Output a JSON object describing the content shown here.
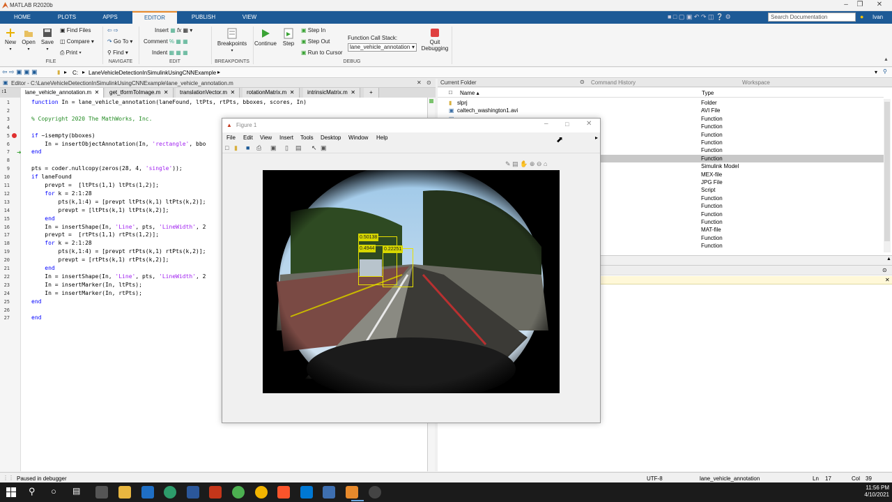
{
  "window": {
    "title": "MATLAB R2020b",
    "user": "Ivan"
  },
  "tabs": [
    "HOME",
    "PLOTS",
    "APPS",
    "EDITOR",
    "PUBLISH",
    "VIEW"
  ],
  "search_placeholder": "Search Documentation",
  "ribbon": {
    "file": {
      "new": "New",
      "open": "Open",
      "save": "Save",
      "find_files": "Find Files",
      "compare": "Compare",
      "print": "Print",
      "group": "FILE"
    },
    "navigate": {
      "goto": "Go To",
      "find": "Find",
      "group": "NAVIGATE"
    },
    "edit": {
      "insert": "Insert",
      "comment": "Comment",
      "indent": "Indent",
      "group": "EDIT"
    },
    "breakpoints": {
      "label": "Breakpoints",
      "group": "BREAKPOINTS"
    },
    "debug": {
      "continue": "Continue",
      "step": "Step",
      "step_in": "Step In",
      "step_out": "Step Out",
      "run_to_cursor": "Run to Cursor",
      "call_stack_label": "Function Call Stack:",
      "call_stack_value": "lane_vehicle_annotation",
      "quit": "Quit",
      "quit2": "Debugging",
      "group": "DEBUG"
    }
  },
  "address": {
    "path": "C: ▸ LaneVehicleDetectionInSimulinkUsingCNNExample ▸",
    "drive": "C:",
    "folder": "LaneVehicleDetectionInSimulinkUsingCNNExample"
  },
  "editor": {
    "header": "Editor - C:\\LaneVehicleDetectionInSimulinkUsingCNNExample\\lane_vehicle_annotation.m",
    "tabs": [
      "lane_vehicle_annotation.m",
      "get_tformToImage.m",
      "translationVector.m",
      "rotationMatrix.m",
      "intrinsicMatrix.m"
    ],
    "lines": [
      "function In = lane_vehicle_annotation(laneFound, ltPts, rtPts, bboxes, scores, In)",
      "",
      "% Copyright 2020 The MathWorks, Inc.",
      "",
      "if ~isempty(bboxes)",
      "    In = insertObjectAnnotation(In, 'rectangle', bbo",
      "end",
      "",
      "pts = coder.nullcopy(zeros(28, 4, 'single'));",
      "if laneFound",
      "    prevpt =  [ltPts(1,1) ltPts(1,2)];",
      "    for k = 2:1:28",
      "        pts(k,1:4) = [prevpt ltPts(k,1) ltPts(k,2)];",
      "        prevpt = [ltPts(k,1) ltPts(k,2)];",
      "    end",
      "    In = insertShape(In, 'Line', pts, 'LineWidth', 2",
      "    prevpt =  [rtPts(1,1) rtPts(1,2)];",
      "    for k = 2:1:28",
      "        pts(k,1:4) = [prevpt rtPts(k,1) rtPts(k,2)];",
      "        prevpt = [rtPts(k,1) rtPts(k,2)];",
      "    end",
      "    In = insertShape(In, 'Line', pts, 'LineWidth', 2",
      "    In = insertMarker(In, ltPts);",
      "    In = insertMarker(In, rtPts);",
      "end",
      "",
      "end"
    ]
  },
  "panels": {
    "current_folder": "Current Folder",
    "command_history": "Command History",
    "workspace": "Workspace",
    "col_name": "Name ▴",
    "col_type": "Type"
  },
  "files": [
    {
      "name": "slprj",
      "type": "Folder"
    },
    {
      "name": "caltech_washington1.avi",
      "type": "AVI File"
    },
    {
      "name": "",
      "type": "Function"
    },
    {
      "name": "",
      "type": "Function"
    },
    {
      "name": "",
      "type": "Function"
    },
    {
      "name": "",
      "type": "Function"
    },
    {
      "name": "",
      "type": "Function"
    },
    {
      "name": "",
      "type": "Function"
    },
    {
      "name": "",
      "type": "Simulink Model"
    },
    {
      "name": "",
      "type": "MEX-file"
    },
    {
      "name": "",
      "type": "JPG File"
    },
    {
      "name": "",
      "type": "Script"
    },
    {
      "name": "",
      "type": "Function"
    },
    {
      "name": "",
      "type": "Function"
    },
    {
      "name": "",
      "type": "Function"
    },
    {
      "name": "",
      "type": "Function"
    },
    {
      "name": "",
      "type": "MAT-file"
    },
    {
      "name": "",
      "type": "Function"
    },
    {
      "name": "",
      "type": "Function"
    }
  ],
  "figure": {
    "title": "Figure 1",
    "menu": [
      "File",
      "Edit",
      "View",
      "Insert",
      "Tools",
      "Desktop",
      "Window",
      "Help"
    ],
    "scores": [
      "0.50138",
      "0.4944",
      "0.22251"
    ]
  },
  "status": {
    "text": "Paused in debugger",
    "encoding": "UTF-8",
    "function": "lane_vehicle_annotation",
    "ln": "Ln",
    "ln_val": "17",
    "col": "Col",
    "col_val": "39"
  },
  "clock": {
    "time": "11:56 PM",
    "date": "4/10/2021"
  }
}
